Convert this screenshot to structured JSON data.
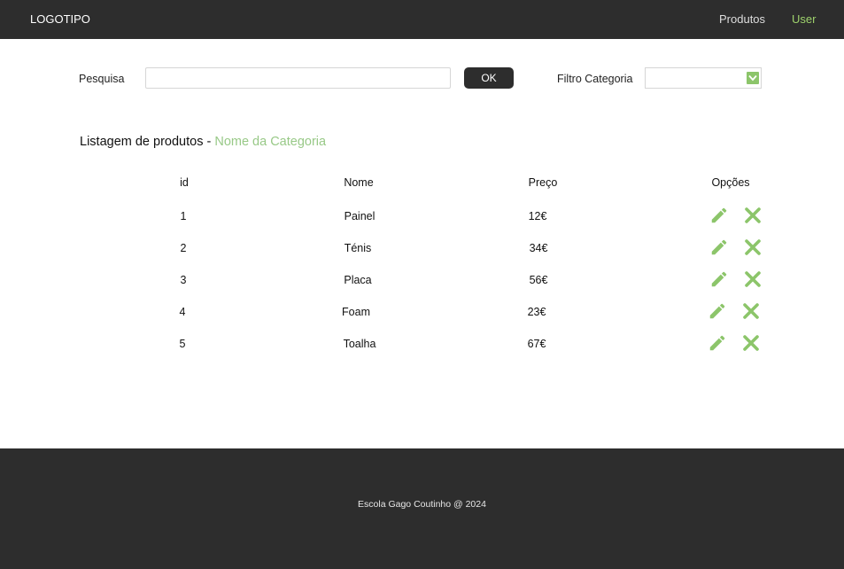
{
  "header": {
    "logo": "LOGOTIPO",
    "nav": {
      "produtos": "Produtos",
      "user": "User"
    }
  },
  "search": {
    "label": "Pesquisa",
    "value": "",
    "placeholder": "",
    "button_label": "OK"
  },
  "filter": {
    "label": "Filtro Categoria",
    "selected": ""
  },
  "listing": {
    "title_prefix": "Listagem de produtos - ",
    "category": "Nome da Categoria"
  },
  "table": {
    "columns": {
      "id": "id",
      "nome": "Nome",
      "preco": "Preço",
      "opcoes": "Opções"
    },
    "rows": [
      {
        "id": "1",
        "nome": "Painel",
        "preco": "12€"
      },
      {
        "id": "2",
        "nome": "Ténis",
        "preco": "34€"
      },
      {
        "id": "3",
        "nome": "Placa",
        "preco": "56€"
      },
      {
        "id": "4",
        "nome": "Foam",
        "preco": "23€"
      },
      {
        "id": "5",
        "nome": "Toalha",
        "preco": "67€"
      }
    ],
    "row_actions": {
      "edit_icon": "pencil-icon",
      "delete_icon": "close-icon"
    }
  },
  "colors": {
    "dark_bar": "#2d2d2d",
    "accent_green": "#9ed26c",
    "category_green": "#98c987",
    "icon_green": "#8cc56a"
  },
  "footer": {
    "text": "Escola Gago Coutinho @ 2024"
  }
}
